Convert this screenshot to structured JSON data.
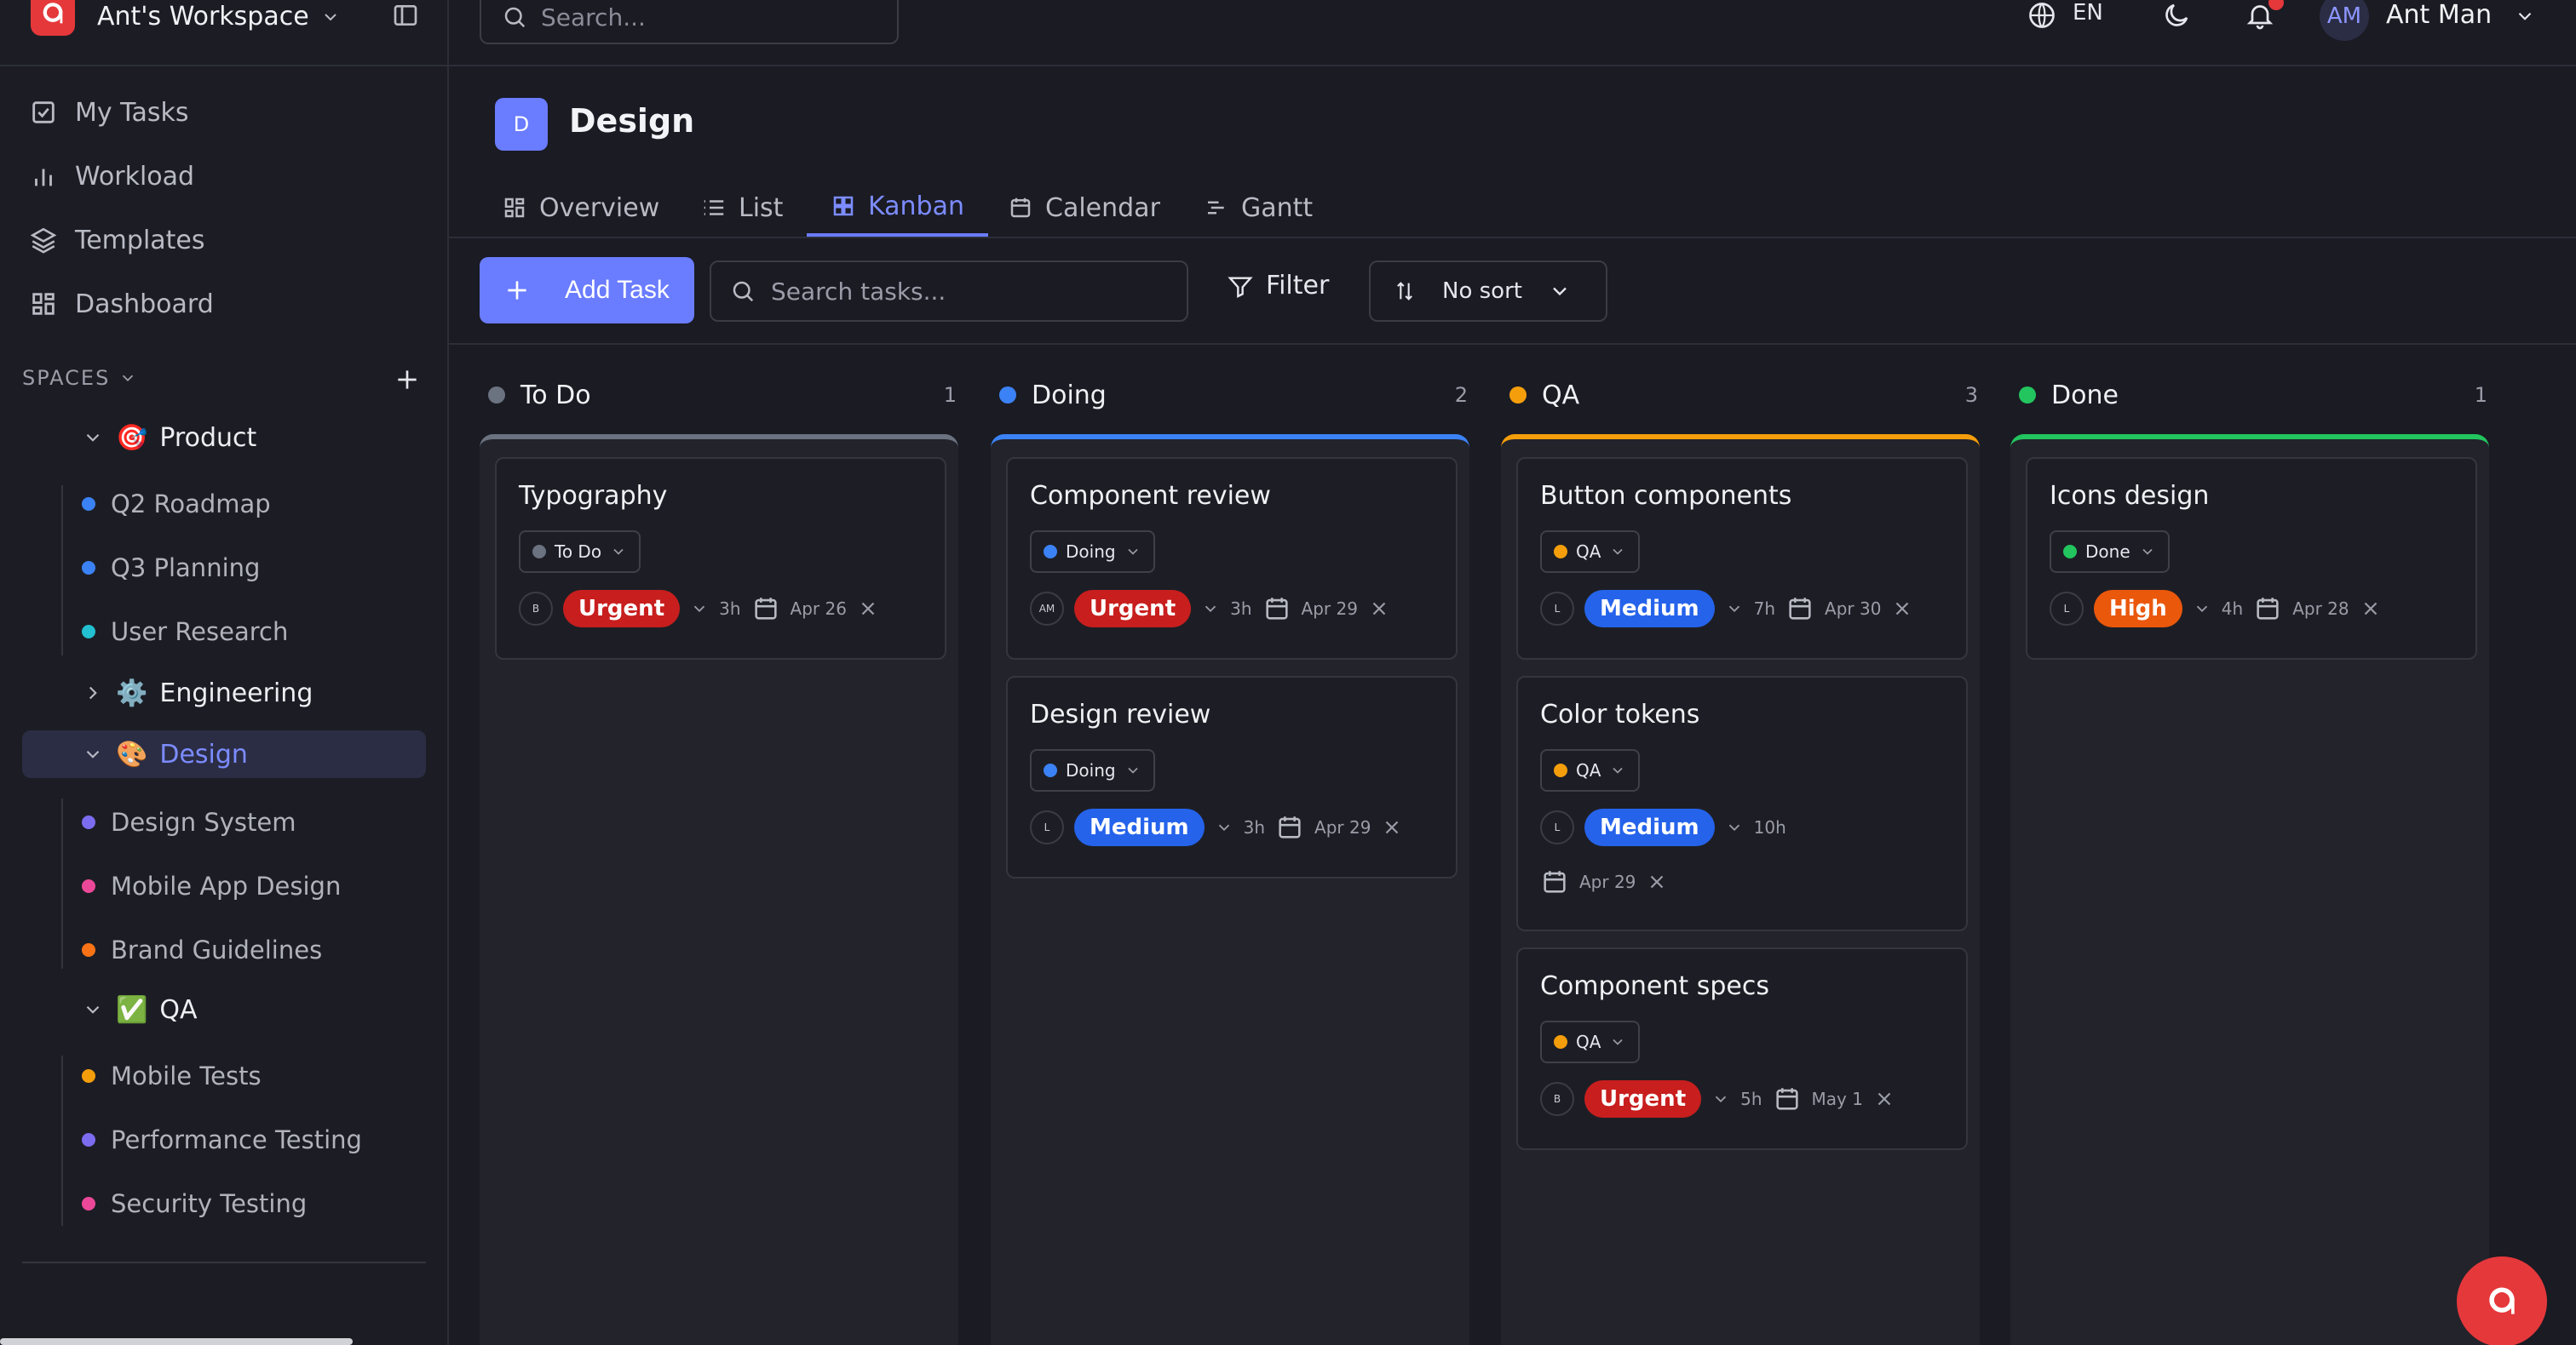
{
  "workspace": {
    "name": "Ant's Workspace"
  },
  "nav": [
    {
      "label": "My Tasks",
      "icon": "check-square-icon"
    },
    {
      "label": "Workload",
      "icon": "bar-chart-icon"
    },
    {
      "label": "Templates",
      "icon": "layers-icon"
    },
    {
      "label": "Dashboard",
      "icon": "grid-icon"
    }
  ],
  "spaces": {
    "label": "SPACES",
    "groups": [
      {
        "emoji": "🎯",
        "name": "Product",
        "expanded": true,
        "items": [
          {
            "label": "Q2 Roadmap",
            "color": "#3b82f6"
          },
          {
            "label": "Q3 Planning",
            "color": "#3b82f6"
          },
          {
            "label": "User Research",
            "color": "#22c0d0"
          }
        ]
      },
      {
        "emoji": "⚙️",
        "name": "Engineering",
        "expanded": false,
        "items": []
      },
      {
        "emoji": "🎨",
        "name": "Design",
        "expanded": true,
        "active": true,
        "items": [
          {
            "label": "Design System",
            "color": "#7c6cf0"
          },
          {
            "label": "Mobile App Design",
            "color": "#ec4899"
          },
          {
            "label": "Brand Guidelines",
            "color": "#f97316"
          }
        ]
      },
      {
        "emoji": "✅",
        "name": "QA",
        "expanded": true,
        "items": [
          {
            "label": "Mobile Tests",
            "color": "#f59e0b"
          },
          {
            "label": "Performance Testing",
            "color": "#7c6cf0"
          },
          {
            "label": "Security Testing",
            "color": "#ec4899"
          }
        ]
      }
    ]
  },
  "topbar": {
    "search_placeholder": "Search...",
    "language": "EN",
    "user_initials": "AM",
    "user_name": "Ant Man"
  },
  "project": {
    "badge": "D",
    "title": "Design",
    "tabs": [
      {
        "label": "Overview",
        "icon": "grid-icon"
      },
      {
        "label": "List",
        "icon": "list-icon"
      },
      {
        "label": "Kanban",
        "icon": "kanban-icon",
        "active": true
      },
      {
        "label": "Calendar",
        "icon": "calendar-icon"
      },
      {
        "label": "Gantt",
        "icon": "gantt-icon"
      }
    ]
  },
  "toolbar": {
    "add_task": "Add Task",
    "search_placeholder": "Search tasks...",
    "filter": "Filter",
    "sort": "No sort"
  },
  "columns": [
    {
      "title": "To Do",
      "count": "1",
      "color": "#6b7280",
      "cards": [
        {
          "title": "Typography",
          "status": "To Do",
          "assignee": "B",
          "priority": "Urgent",
          "estimate": "3h",
          "due": "Apr 26"
        }
      ]
    },
    {
      "title": "Doing",
      "count": "2",
      "color": "#3b82f6",
      "cards": [
        {
          "title": "Component review",
          "status": "Doing",
          "assignee": "AM",
          "priority": "Urgent",
          "estimate": "3h",
          "due": "Apr 29"
        },
        {
          "title": "Design review",
          "status": "Doing",
          "assignee": "L",
          "priority": "Medium",
          "estimate": "3h",
          "due": "Apr 29"
        }
      ]
    },
    {
      "title": "QA",
      "count": "3",
      "color": "#f59e0b",
      "cards": [
        {
          "title": "Button components",
          "status": "QA",
          "assignee": "L",
          "priority": "Medium",
          "estimate": "7h",
          "due": "Apr 30"
        },
        {
          "title": "Color tokens",
          "status": "QA",
          "assignee": "L",
          "priority": "Medium",
          "estimate": "10h",
          "due": "Apr 29"
        },
        {
          "title": "Component specs",
          "status": "QA",
          "assignee": "B",
          "priority": "Urgent",
          "estimate": "5h",
          "due": "May 1"
        }
      ]
    },
    {
      "title": "Done",
      "count": "1",
      "color": "#22c55e",
      "cards": [
        {
          "title": "Icons design",
          "status": "Done",
          "assignee": "L",
          "priority": "High",
          "estimate": "4h",
          "due": "Apr 28"
        }
      ]
    }
  ],
  "priority_colors": {
    "Urgent": "#c81e1e",
    "Medium": "#2563eb",
    "High": "#ea580c"
  }
}
